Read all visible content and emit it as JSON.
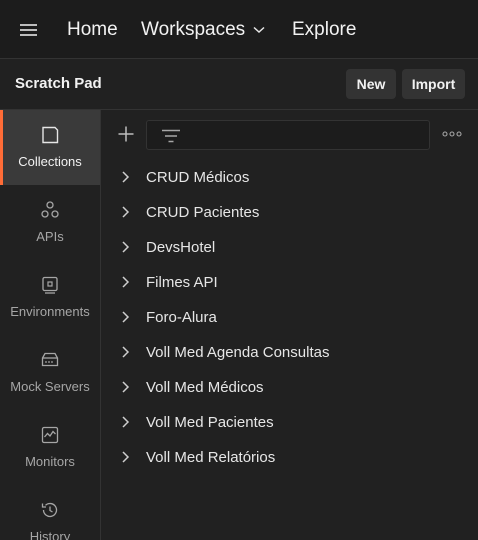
{
  "topnav": {
    "home": "Home",
    "workspaces": "Workspaces",
    "explore": "Explore"
  },
  "header": {
    "title": "Scratch Pad",
    "new_label": "New",
    "import_label": "Import"
  },
  "sidebar": {
    "items": [
      {
        "label": "Collections",
        "icon": "collections-icon",
        "active": true
      },
      {
        "label": "APIs",
        "icon": "apis-icon"
      },
      {
        "label": "Environments",
        "icon": "environments-icon"
      },
      {
        "label": "Mock Servers",
        "icon": "mock-servers-icon"
      },
      {
        "label": "Monitors",
        "icon": "monitors-icon"
      },
      {
        "label": "History",
        "icon": "history-icon"
      }
    ]
  },
  "collections": [
    "CRUD Médicos",
    "CRUD Pacientes",
    "DevsHotel",
    "Filmes API",
    "Foro-Alura",
    "Voll Med Agenda Consultas",
    "Voll Med Médicos",
    "Voll Med Pacientes",
    "Voll Med Relatórios"
  ],
  "colors": {
    "accent": "#ff6c37",
    "background": "#212121"
  }
}
